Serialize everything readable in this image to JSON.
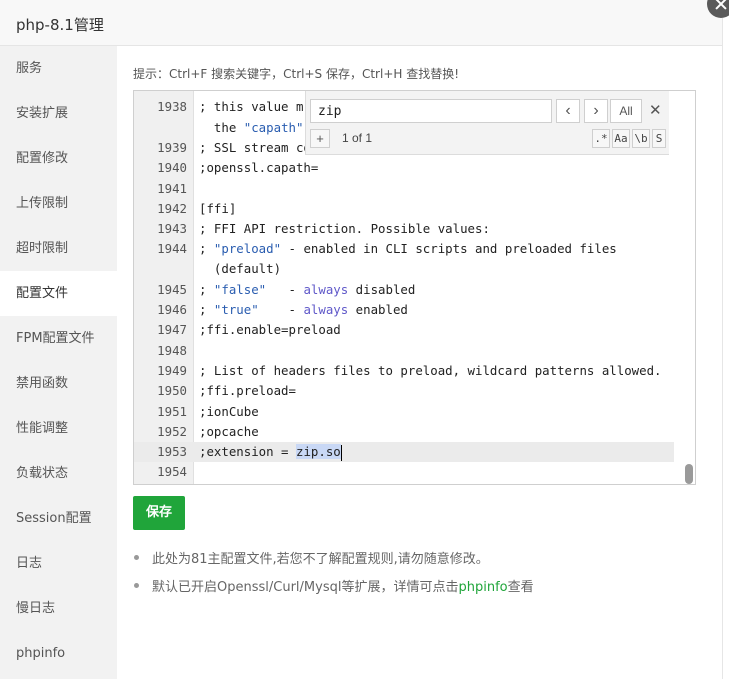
{
  "window": {
    "title": "php-8.1管理"
  },
  "sidebar": {
    "items": [
      {
        "label": "服务"
      },
      {
        "label": "安装扩展"
      },
      {
        "label": "配置修改"
      },
      {
        "label": "上传限制"
      },
      {
        "label": "超时限制"
      },
      {
        "label": "配置文件"
      },
      {
        "label": "FPM配置文件"
      },
      {
        "label": "禁用函数"
      },
      {
        "label": "性能调整"
      },
      {
        "label": "负载状态"
      },
      {
        "label": "Session配置"
      },
      {
        "label": "日志"
      },
      {
        "label": "慢日志"
      },
      {
        "label": "phpinfo"
      }
    ],
    "active_index": 5
  },
  "hint": "提示：Ctrl+F 搜索关键字，Ctrl+S 保存，Ctrl+H 查找替换!",
  "editor": {
    "lines": [
      {
        "num": "1938",
        "text": "; this value m"
      },
      {
        "num": "",
        "text": "  the \"capath\""
      },
      {
        "num": "1939",
        "text": "; SSL stream co"
      },
      {
        "num": "1940",
        "text": ";openssl.capath="
      },
      {
        "num": "1941",
        "text": ""
      },
      {
        "num": "1942",
        "text": "[ffi]"
      },
      {
        "num": "1943",
        "text": "; FFI API restriction. Possible values:"
      },
      {
        "num": "1944",
        "text": "; \"preload\" - enabled in CLI scripts and preloaded files"
      },
      {
        "num": "",
        "text": "  (default)"
      },
      {
        "num": "1945",
        "text": "; \"false\"   - always disabled"
      },
      {
        "num": "1946",
        "text": "; \"true\"    - always enabled"
      },
      {
        "num": "1947",
        "text": ";ffi.enable=preload"
      },
      {
        "num": "1948",
        "text": ""
      },
      {
        "num": "1949",
        "text": "; List of headers files to preload, wildcard patterns allowed."
      },
      {
        "num": "1950",
        "text": ";ffi.preload="
      },
      {
        "num": "1951",
        "text": ";ionCube"
      },
      {
        "num": "1952",
        "text": ";opcache"
      },
      {
        "num": "1953",
        "text": ";extension = zip.so"
      },
      {
        "num": "1954",
        "text": ""
      }
    ],
    "active_line": "1953"
  },
  "search": {
    "query": "zip",
    "prev_symbol": "‹",
    "next_symbol": "›",
    "all_label": "All",
    "close_symbol": "✕",
    "replace_toggle": "+",
    "match_count": "1 of 1",
    "options": [
      ".*",
      "Aa",
      "\\b",
      "S"
    ]
  },
  "save_button": "保存",
  "notes": {
    "note1": "此处为81主配置文件,若您不了解配置规则,请勿随意修改。",
    "note2_prefix": "默认已开启Openssl/Curl/Mysql等扩展，详情可点击",
    "note2_link": "phpinfo",
    "note2_suffix": "查看"
  },
  "colors": {
    "accent": "#20a53a",
    "string": "#2a5db0",
    "keyword": "#5f58c9",
    "selection": "#c9d8f5"
  }
}
